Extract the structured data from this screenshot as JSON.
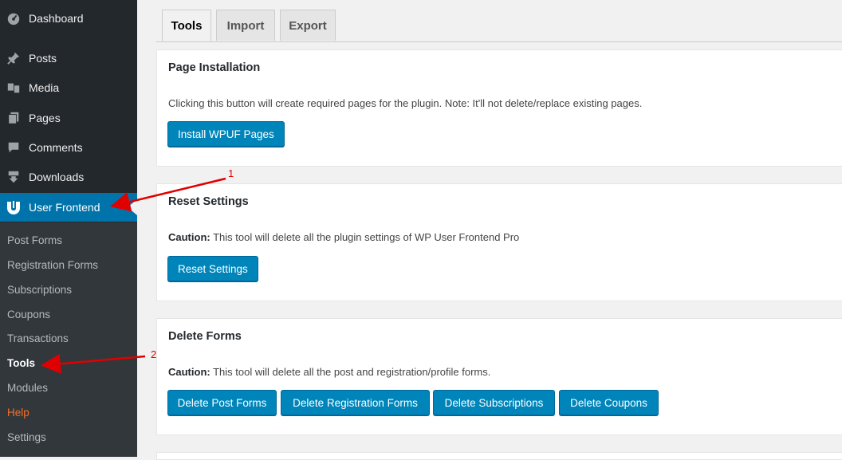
{
  "sidebar": {
    "items": [
      {
        "label": "Dashboard",
        "icon": "dashboard-icon"
      },
      {
        "label": "Posts",
        "icon": "pin-icon"
      },
      {
        "label": "Media",
        "icon": "media-icon"
      },
      {
        "label": "Pages",
        "icon": "pages-icon"
      },
      {
        "label": "Comments",
        "icon": "comment-icon"
      },
      {
        "label": "Downloads",
        "icon": "download-icon"
      },
      {
        "label": "User Frontend",
        "icon": "user-frontend-icon",
        "active": true
      }
    ],
    "submenu": [
      "Post Forms",
      "Registration Forms",
      "Subscriptions",
      "Coupons",
      "Transactions",
      "Tools",
      "Modules",
      "Help",
      "Settings"
    ],
    "submenu_current": "Tools"
  },
  "tabs": [
    "Tools",
    "Import",
    "Export"
  ],
  "active_tab": "Tools",
  "panels": {
    "page_install": {
      "title": "Page Installation",
      "desc": "Clicking this button will create required pages for the plugin. Note: It'll not delete/replace existing pages.",
      "button": "Install WPUF Pages"
    },
    "reset": {
      "title": "Reset Settings",
      "caution_label": "Caution:",
      "desc": " This tool will delete all the plugin settings of WP User Frontend Pro",
      "button": "Reset Settings"
    },
    "delete_forms": {
      "title": "Delete Forms",
      "caution_label": "Caution:",
      "desc": " This tool will delete all the post and registration/profile forms.",
      "buttons": [
        "Delete Post Forms",
        "Delete Registration Forms",
        "Delete Subscriptions",
        "Delete Coupons"
      ]
    }
  },
  "annotations": [
    "1",
    "2"
  ],
  "colors": {
    "sidebar_bg": "#23282d",
    "submenu_bg": "#32373c",
    "accent": "#0073aa",
    "button": "#0085ba",
    "help": "#f56e28",
    "annotation": "#e10000"
  }
}
